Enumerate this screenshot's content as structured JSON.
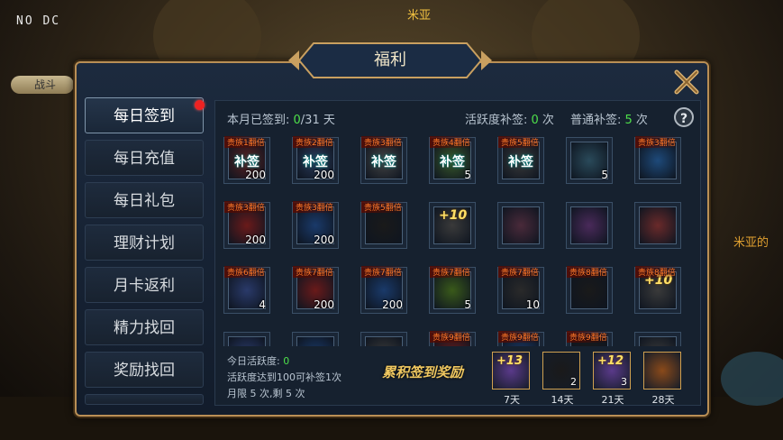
{
  "hud": {
    "top_left": "NO DC",
    "npc_name": "米亚",
    "npc_side_text": "米亚的"
  },
  "top_tab_label": "战斗",
  "title": "福利",
  "sidebar": {
    "items": [
      {
        "label": "每日签到",
        "active": true,
        "notify": true
      },
      {
        "label": "每日充值"
      },
      {
        "label": "每日礼包"
      },
      {
        "label": "理财计划"
      },
      {
        "label": "月卡返利"
      },
      {
        "label": "精力找回"
      },
      {
        "label": "奖励找回"
      }
    ]
  },
  "stats": {
    "signed_label": "本月已签到: ",
    "signed_value": "0",
    "signed_total": "/31 天",
    "active_label": "活跃度补签: ",
    "active_value": "0",
    "active_unit": " 次",
    "normal_label": "普通补签: ",
    "normal_value": "5",
    "normal_unit": " 次",
    "help": "?"
  },
  "grid": {
    "rows": [
      [
        {
          "tag": "贵族1翻倍",
          "label": "补签",
          "qty": "200",
          "icon": "scroll-icon",
          "color": "#5a2020"
        },
        {
          "tag": "贵族2翻倍",
          "label": "补签",
          "qty": "200",
          "icon": "scroll-icon",
          "color": "#2a3a5a"
        },
        {
          "tag": "贵族3翻倍",
          "label": "补签",
          "qty": "",
          "icon": "sword-icon",
          "color": "#444"
        },
        {
          "tag": "贵族4翻倍",
          "label": "补签",
          "qty": "5",
          "icon": "potion-icon",
          "color": "#3a5a2a"
        },
        {
          "tag": "贵族5翻倍",
          "label": "补签",
          "qty": "",
          "icon": "plus-stone-icon",
          "color": "#3a3a3a"
        },
        {
          "tag": "",
          "label": "",
          "qty": "5",
          "icon": "dice-box-icon",
          "color": "#2a4a5a"
        },
        {
          "tag": "贵族3翻倍",
          "label": "",
          "qty": "",
          "icon": "mystery-orb-icon",
          "color": "#1e4a7a"
        }
      ],
      [
        {
          "tag": "贵族3翻倍",
          "label": "",
          "qty": "200",
          "icon": "red-scroll-icon",
          "color": "#6a1a1a"
        },
        {
          "tag": "贵族3翻倍",
          "label": "",
          "qty": "200",
          "icon": "blue-scroll-icon",
          "color": "#1a3a6a"
        },
        {
          "tag": "贵族5翻倍",
          "label": "",
          "qty": "",
          "icon": "sword-icon",
          "color": "#1a1a1a"
        },
        {
          "tag": "",
          "label": "",
          "qty": "",
          "plus": "+10",
          "icon": "plus-stone-icon",
          "color": "#3a3a3a"
        },
        {
          "tag": "",
          "label": "",
          "qty": "",
          "icon": "gift-bag-icon",
          "color": "#4a2a3a"
        },
        {
          "tag": "",
          "label": "",
          "qty": "",
          "icon": "purple-bag-icon",
          "color": "#4a2a5a"
        },
        {
          "tag": "",
          "label": "",
          "qty": "",
          "icon": "mystery-box-icon",
          "color": "#6a2a2a"
        }
      ],
      [
        {
          "tag": "贵族6翻倍",
          "label": "",
          "qty": "4",
          "icon": "potion-bottle-icon",
          "color": "#2a3a6a"
        },
        {
          "tag": "贵族7翻倍",
          "label": "",
          "qty": "200",
          "icon": "red-scroll-icon",
          "color": "#6a1a1a"
        },
        {
          "tag": "贵族7翻倍",
          "label": "",
          "qty": "200",
          "icon": "blue-scroll-icon",
          "color": "#1a3a6a"
        },
        {
          "tag": "贵族7翻倍",
          "label": "",
          "qty": "5",
          "icon": "exp-potion-icon",
          "color": "#3a5a1a"
        },
        {
          "tag": "贵族7翻倍",
          "label": "",
          "qty": "10",
          "icon": "dice-box-icon",
          "color": "#2a2a2a"
        },
        {
          "tag": "贵族8翻倍",
          "label": "",
          "qty": "",
          "icon": "sword-icon",
          "color": "#1a1a1a"
        },
        {
          "tag": "贵族8翻倍",
          "label": "",
          "qty": "",
          "plus": "+10",
          "icon": "plus-stone-icon",
          "color": "#3a3a3a"
        }
      ],
      [
        {
          "tag": "",
          "label": "",
          "qty": "",
          "icon": "potion-bottle-icon",
          "color": "#2a3a6a"
        },
        {
          "tag": "",
          "label": "",
          "qty": "",
          "icon": "blue-scroll-icon",
          "color": "#1a3a6a"
        },
        {
          "tag": "",
          "label": "",
          "qty": "",
          "icon": "dice-box-icon",
          "color": "#3a3a3a"
        },
        {
          "tag": "贵族9翻倍",
          "label": "",
          "qty": "",
          "icon": "red-scroll-icon",
          "color": "#6a1a1a"
        },
        {
          "tag": "贵族9翻倍",
          "label": "",
          "qty": "",
          "icon": "blue-scroll-icon",
          "color": "#1a3a6a"
        },
        {
          "tag": "贵族9翻倍",
          "label": "",
          "qty": "",
          "icon": "sword-icon",
          "color": "#1a1a1a"
        },
        {
          "tag": "",
          "label": "",
          "qty": "",
          "icon": "dice-box-icon",
          "color": "#3a3a3a"
        }
      ]
    ]
  },
  "bottom": {
    "today_label": "今日活跃度: ",
    "today_value": "0",
    "rule1": "活跃度达到100可补签1次",
    "rule2": "月限 5 次,剩 5 次",
    "cumulative_label": "累积签到奖励",
    "rewards": [
      {
        "plus": "+13",
        "qty": "",
        "day": "7天",
        "icon": "plus13-stone-icon",
        "color": "#5a3a8a"
      },
      {
        "plus": "",
        "qty": "2",
        "day": "14天",
        "icon": "sword-icon",
        "color": "#1a1a1a"
      },
      {
        "plus": "+12",
        "qty": "3",
        "day": "21天",
        "icon": "plus12-stone-icon",
        "color": "#5a3a8a"
      },
      {
        "plus": "",
        "qty": "",
        "day": "28天",
        "icon": "sign-card-icon",
        "color": "#8a4a1a"
      }
    ]
  }
}
